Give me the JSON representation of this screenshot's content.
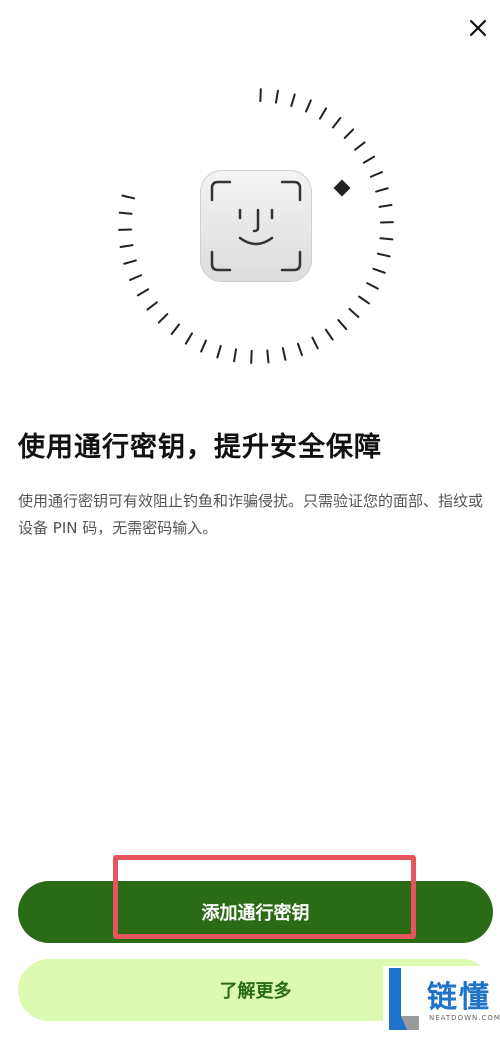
{
  "header": {
    "close_icon": "close-icon"
  },
  "hero": {
    "icon": "face-id-icon",
    "progress_marker_icon": "diamond-icon"
  },
  "content": {
    "title": "使用通行密钥，提升安全保障",
    "description": "使用通行密钥可有效阻止钓鱼和诈骗侵扰。只需验证您的面部、指纹或设备 PIN 码，无需密码输入。"
  },
  "actions": {
    "primary_label": "添加通行密钥",
    "secondary_label": "了解更多"
  },
  "watermark": {
    "text": "链懂",
    "subtext": "NEATDOWN.COM"
  },
  "colors": {
    "primary_green": "#2b6b15",
    "secondary_bg": "#dcfbb0",
    "highlight_red": "#e6555e",
    "watermark_blue": "#1f73c8"
  }
}
